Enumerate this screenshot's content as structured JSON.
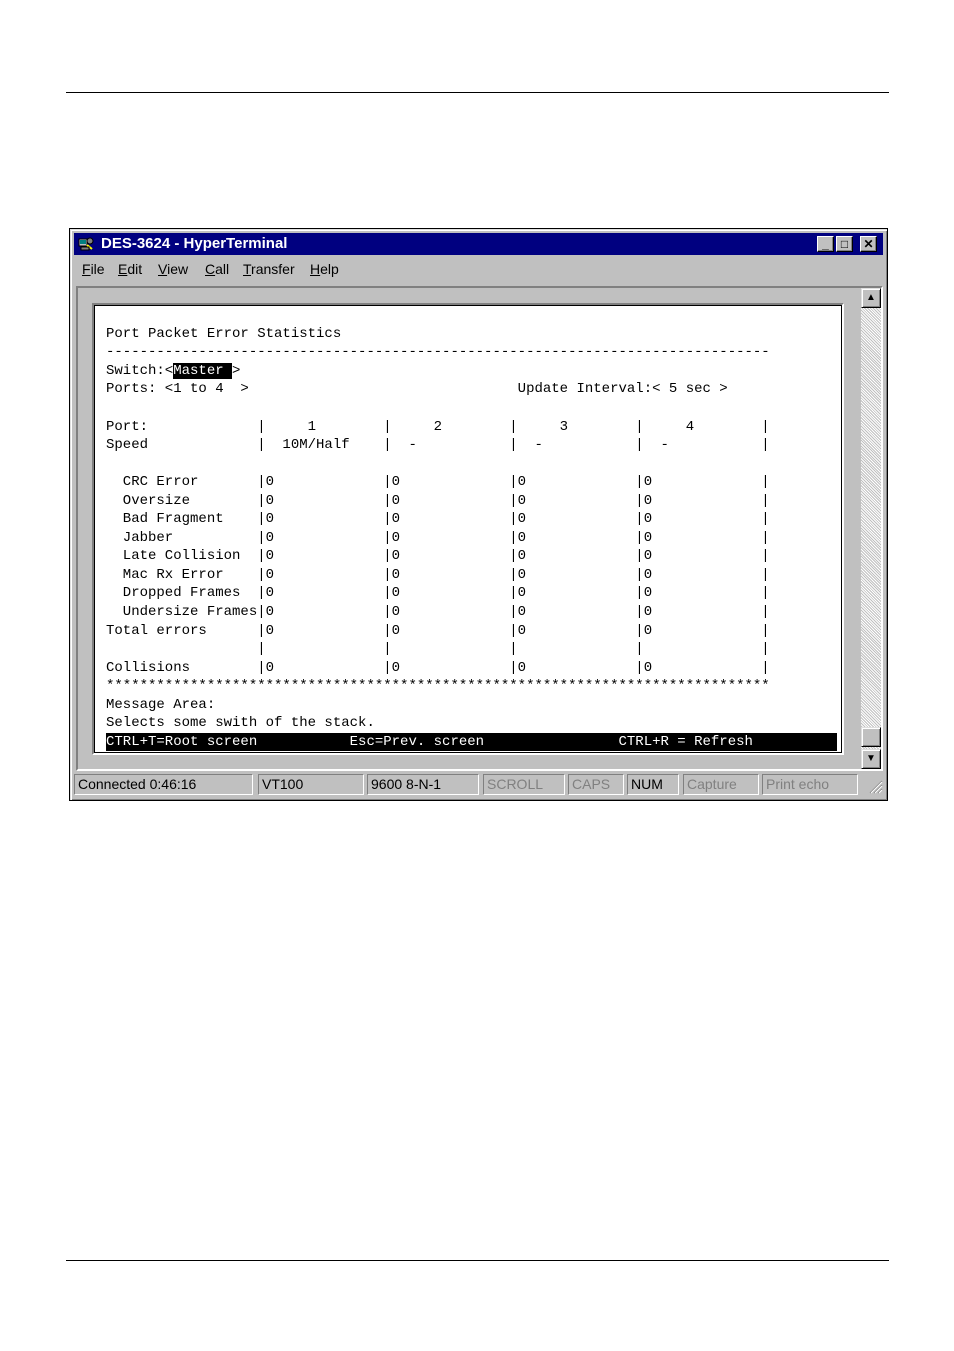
{
  "window": {
    "title": "DES-3624 - HyperTerminal",
    "controls": {
      "minimize": "_",
      "maximize": "□",
      "close": "✕"
    }
  },
  "menu": [
    {
      "accel": "F",
      "rest": "ile"
    },
    {
      "accel": "E",
      "rest": "dit"
    },
    {
      "accel": "V",
      "rest": "iew"
    },
    {
      "accel": "C",
      "rest": "all"
    },
    {
      "accel": "T",
      "rest": "ransfer"
    },
    {
      "accel": "H",
      "rest": "elp"
    }
  ],
  "terminal": {
    "title": "Port Packet Error Statistics",
    "separator": "-------------------------------------------------------------------------------",
    "switch_label": "Switch:<",
    "switch_value": "Master ",
    "switch_close": ">",
    "ports_line": "Ports: <1 to 4  >                                Update Interval:< 5 sec >",
    "port_header": "Port:             |     1        |     2        |     3        |     4        |",
    "speed_line": "Speed             |  10M/Half    |  -           |  -           |  -           |",
    "rows": [
      "  CRC Error       |0             |0             |0             |0             |",
      "  Oversize        |0             |0             |0             |0             |",
      "  Bad Fragment    |0             |0             |0             |0             |",
      "  Jabber          |0             |0             |0             |0             |",
      "  Late Collision  |0             |0             |0             |0             |",
      "  Mac Rx Error    |0             |0             |0             |0             |",
      "  Dropped Frames  |0             |0             |0             |0             |",
      "  Undersize Frames|0             |0             |0             |0             |",
      "Total errors      |0             |0             |0             |0             |",
      "                  |              |              |              |              |",
      "Collisions        |0             |0             |0             |0             |"
    ],
    "stars": "*******************************************************************************",
    "message_label": "Message Area:",
    "message_text": "Selects some swith of the stack.",
    "status_line": "CTRL+T=Root screen           Esc=Prev. screen                CTRL+R = Refresh"
  },
  "statusbar": {
    "connected": "Connected 0:46:16",
    "emulation": "VT100",
    "settings": "9600 8-N-1",
    "scroll": "SCROLL",
    "caps": "CAPS",
    "num": "NUM",
    "capture": "Capture",
    "print_echo": "Print echo"
  }
}
